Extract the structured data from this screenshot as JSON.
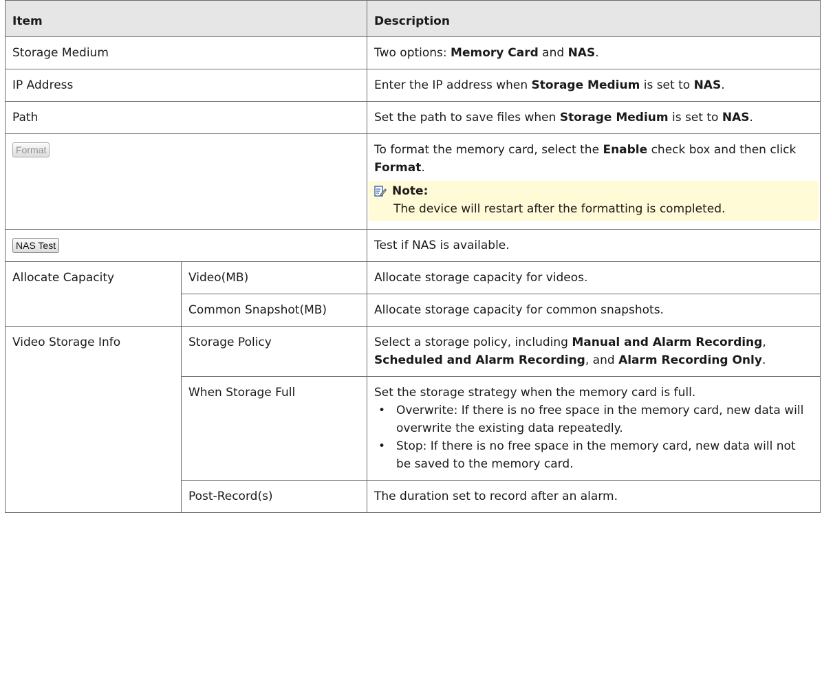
{
  "header": {
    "item": "Item",
    "description": "Description"
  },
  "rows": {
    "storage_medium": {
      "item": "Storage Medium",
      "desc_pre": "Two options: ",
      "opt1": "Memory Card",
      "and": " and ",
      "opt2": "NAS",
      "end": "."
    },
    "ip_address": {
      "item": "IP Address",
      "desc_pre": "Enter the IP address when ",
      "field": "Storage Medium",
      "mid": " is set to ",
      "value": "NAS",
      "end": "."
    },
    "path": {
      "item": "Path",
      "desc_pre": "Set the path to save files when ",
      "field": "Storage Medium",
      "mid": " is set to ",
      "value": "NAS",
      "end": "."
    },
    "format": {
      "button": "Format",
      "desc_pre": "To format the memory card, select the ",
      "enable": "Enable",
      "mid": " check box and then click ",
      "format": "Format",
      "end": ".",
      "note_title": "Note:",
      "note_text": "The device will restart after the formatting is completed."
    },
    "nas_test": {
      "button": "NAS Test",
      "desc": "Test if NAS is available."
    },
    "allocate": {
      "item": "Allocate Capacity",
      "video_label": "Video(MB)",
      "video_desc": "Allocate storage capacity for videos.",
      "snapshot_label": "Common Snapshot(MB)",
      "snapshot_desc": "Allocate storage capacity for common snapshots."
    },
    "video_storage": {
      "item": "Video Storage Info",
      "policy_label": "Storage Policy",
      "policy_pre": "Select a storage policy, including ",
      "policy_1": "Manual and Alarm Recording",
      "sep1": ", ",
      "policy_2": "Scheduled and Alarm Recording",
      "sep2": ", and ",
      "policy_3": "Alarm Recording Only",
      "end": ".",
      "full_label": "When Storage Full",
      "full_desc": "Set the storage strategy when the memory card is full.",
      "full_bullets": [
        "Overwrite: If there is no free space in the memory card, new data will overwrite the existing data repeatedly.",
        "Stop: If there is no free space in the memory card, new data will not be saved to the memory card."
      ],
      "post_label": "Post-Record(s)",
      "post_desc": "The duration set to record after an alarm."
    }
  }
}
